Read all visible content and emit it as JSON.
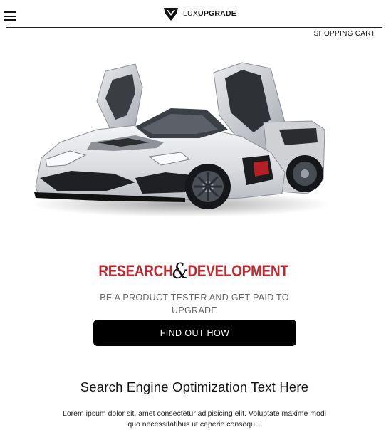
{
  "header": {
    "logo": {
      "icon": "lux-upgrade-v-shield-icon",
      "text_light": "LUX",
      "text_bold": "UPGRADE"
    },
    "menu_icon": "hamburger-menu-icon",
    "cart_label": "SHOPPING CART"
  },
  "hero": {
    "image": "white-supercar-gullwing-doors-image"
  },
  "promo": {
    "title_left": "RESEARCH",
    "title_amp": "&",
    "title_right": "DEVELOPMENT",
    "subtitle": "BE A PRODUCT TESTER AND GET PAID TO UPGRADE",
    "cta_label": "FIND OUT HOW"
  },
  "seo": {
    "heading": "Search Engine Optimization Text Here",
    "body": "Lorem ipsum dolor sit, amet consectetur adipisicing elit. Voluptate maxime modi quo necessitatibus ut ceperie consequ..."
  },
  "colors": {
    "brand_red": "#c1272d",
    "button_bg": "#000000",
    "subtitle_gray": "#666666"
  }
}
